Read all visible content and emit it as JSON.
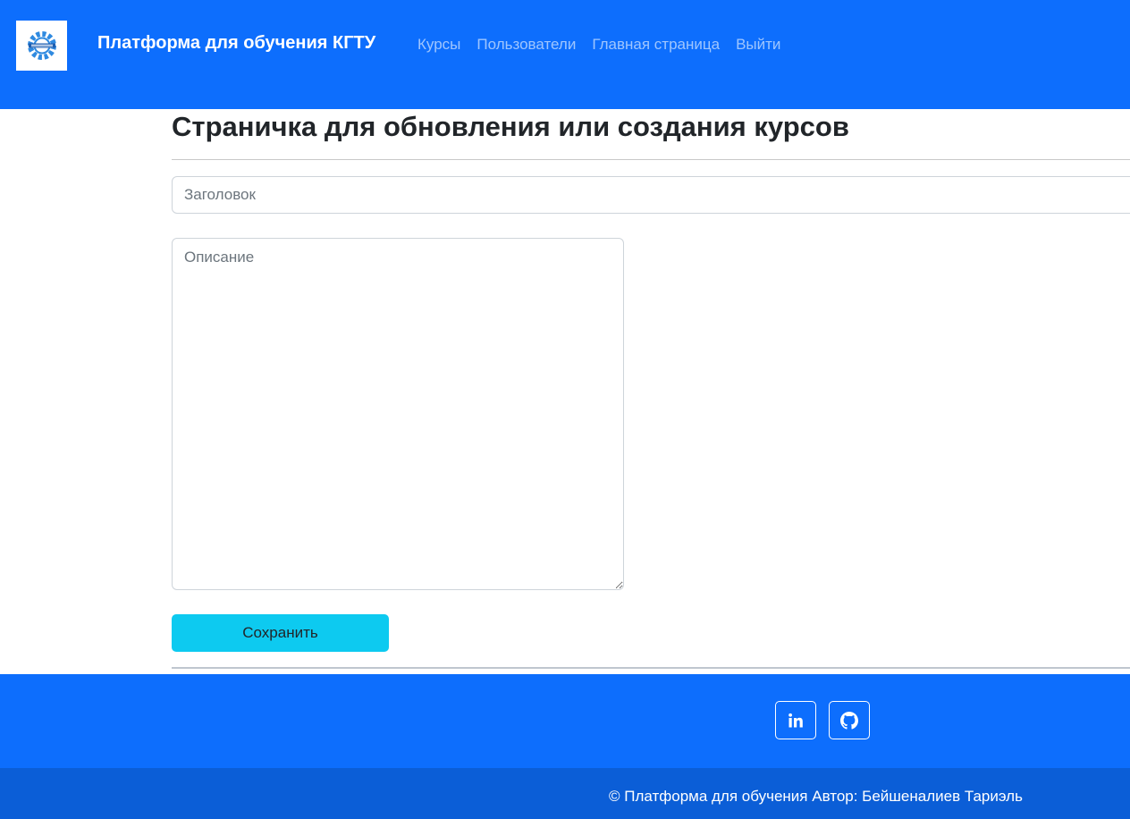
{
  "navbar": {
    "logo_icon": "kgtu-gear-logo-icon",
    "brand": "Платформа для обучения КГТУ",
    "links": [
      {
        "label": "Курсы"
      },
      {
        "label": "Пользователи"
      },
      {
        "label": "Главная страница"
      },
      {
        "label": "Выйти"
      }
    ]
  },
  "main": {
    "title": "Страничка для обновления или создания курсов",
    "form": {
      "title_placeholder": "Заголовок",
      "title_value": "",
      "description_placeholder": "Описание",
      "description_value": "",
      "save_label": "Сохранить"
    }
  },
  "footer": {
    "social": [
      {
        "icon": "linkedin-icon"
      },
      {
        "icon": "github-icon"
      }
    ],
    "copyright": "© Платформа для обучения Автор: Бейшеналиев Тариэль"
  },
  "colors": {
    "primary": "#0d6efd",
    "primary_dark": "#0b5ed7",
    "info": "#0dcaf0"
  }
}
